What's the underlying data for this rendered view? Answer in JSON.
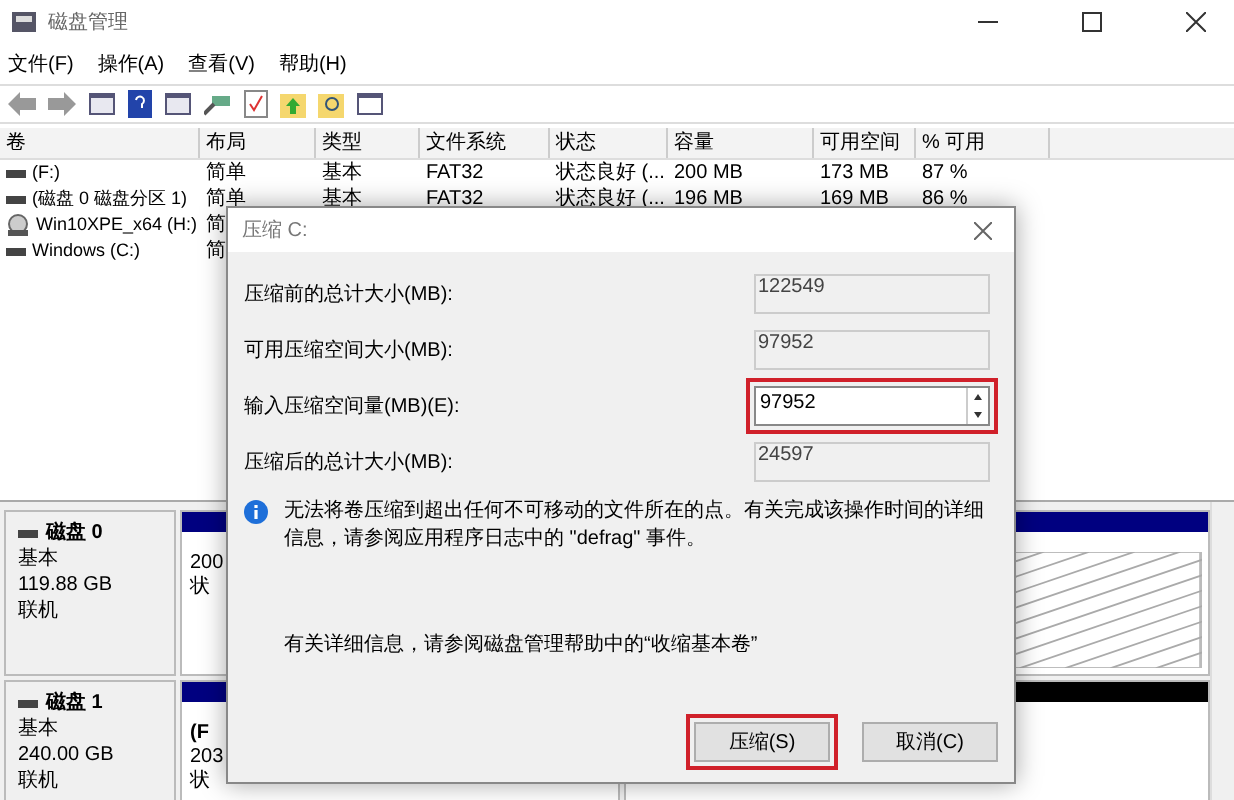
{
  "window": {
    "title": "磁盘管理"
  },
  "menu": [
    {
      "label": "文件(F)"
    },
    {
      "label": "操作(A)"
    },
    {
      "label": "查看(V)"
    },
    {
      "label": "帮助(H)"
    }
  ],
  "table": {
    "columns": [
      "卷",
      "布局",
      "类型",
      "文件系统",
      "状态",
      "容量",
      "可用空间",
      "% 可用"
    ],
    "rows": [
      {
        "kind": "disk",
        "cells": [
          "(F:)",
          "简单",
          "基本",
          "FAT32",
          "状态良好 (...",
          "200 MB",
          "173 MB",
          "87 %"
        ]
      },
      {
        "kind": "disk",
        "cells": [
          "(磁盘 0 磁盘分区 1)",
          "简单",
          "基本",
          "FAT32",
          "状态良好 (...",
          "196 MB",
          "169 MB",
          "86 %"
        ]
      },
      {
        "kind": "optical",
        "cells": [
          "Win10XPE_x64 (H:)",
          "简"
        ]
      },
      {
        "kind": "disk",
        "cells": [
          "Windows (C:)",
          "简"
        ]
      }
    ]
  },
  "disks": [
    {
      "name": "磁盘 0",
      "type": "基本",
      "size": "119.88 GB",
      "status": "联机",
      "partitions": [
        {
          "color": "#000080",
          "lines": [
            "200",
            "状"
          ],
          "hatched": false
        },
        {
          "color": "#000080",
          "hatched": true
        }
      ]
    },
    {
      "name": "磁盘 1",
      "type": "基本",
      "size": "240.00 GB",
      "status": "联机",
      "partitions": [
        {
          "color": "#000080",
          "lines": [
            "(F",
            "203",
            "状"
          ],
          "hatched": false
        },
        {
          "color": "#000000",
          "hatched": false
        }
      ]
    }
  ],
  "dialog": {
    "title": "压缩 C:",
    "fields": [
      {
        "kind": "readonly",
        "label": "压缩前的总计大小(MB):",
        "value": "122549",
        "highlighted": false
      },
      {
        "kind": "readonly",
        "label": "可用压缩空间大小(MB):",
        "value": "97952",
        "highlighted": false
      },
      {
        "kind": "spin",
        "label": "输入压缩空间量(MB)(E):",
        "value": "97952",
        "highlighted": true
      },
      {
        "kind": "readonly",
        "label": "压缩后的总计大小(MB):",
        "value": "24597",
        "highlighted": false
      }
    ],
    "info": "无法将卷压缩到超出任何不可移动的文件所在的点。有关完成该操作时间的详细信息，请参阅应用程序日志中的 \"defrag\" 事件。",
    "help": "有关详细信息，请参阅磁盘管理帮助中的“收缩基本卷”",
    "buttons": [
      {
        "label": "压缩(S)",
        "highlighted": true
      },
      {
        "label": "取消(C)",
        "highlighted": false
      }
    ]
  }
}
